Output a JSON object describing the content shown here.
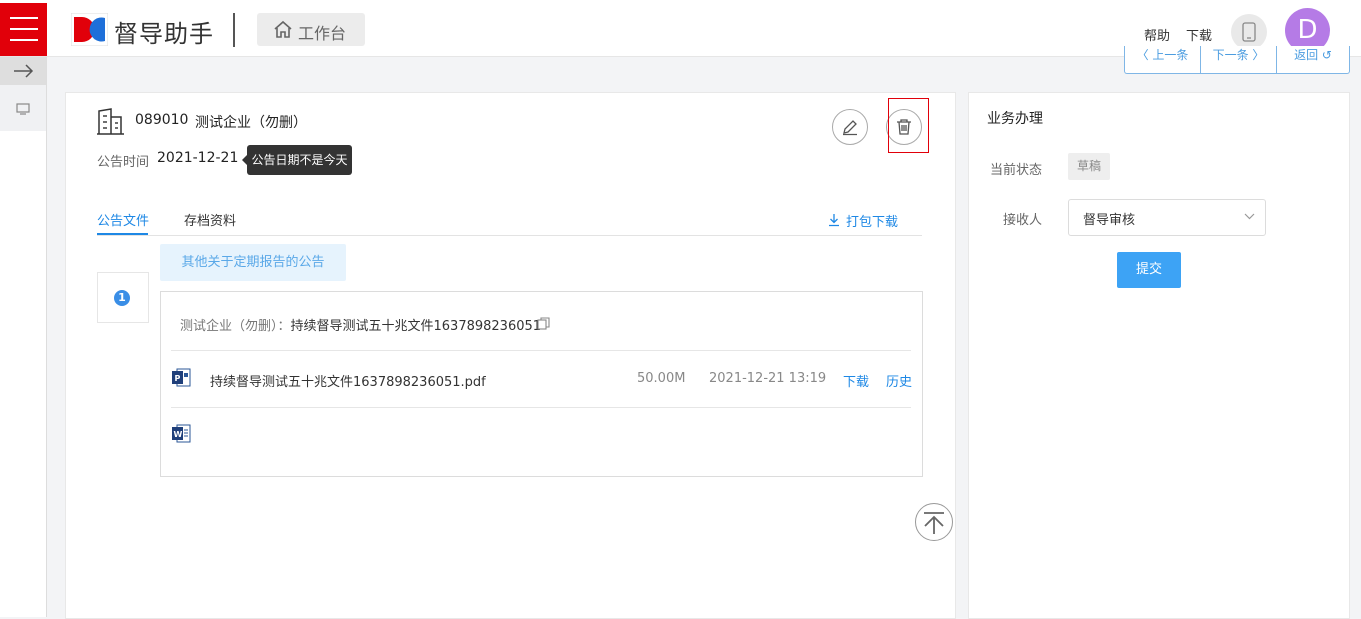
{
  "header": {
    "app_title": "督导助手",
    "workbench_label": "工作台",
    "help_label": "帮助",
    "download_label": "下载",
    "avatar_initial": "D"
  },
  "nav": {
    "prev_label": "〈 上一条",
    "next_label": "下一条 〉",
    "back_label": "返回 ↺"
  },
  "record": {
    "code": "089010",
    "company": "测试企业（勿删）",
    "date_label": "公告时间",
    "date_value": "2021-12-21",
    "tooltip": "公告日期不是今天"
  },
  "tabs": [
    {
      "label": "公告文件",
      "active": true
    },
    {
      "label": "存档资料",
      "active": false
    }
  ],
  "download_all": "打包下载",
  "notice_category": "其他关于定期报告的公告",
  "item_number": "1",
  "item": {
    "prefix": "测试企业（勿删）：",
    "title": "持续督导测试五十兆文件1637898236051"
  },
  "files": [
    {
      "icon": "pdf-file-icon",
      "name": "持续督导测试五十兆文件1637898236051.pdf",
      "size": "50.00M",
      "time": "2021-12-21 13:19",
      "download": "下载",
      "history": "历史"
    },
    {
      "icon": "word-file-icon",
      "name": "",
      "size": "",
      "time": "",
      "download": "",
      "history": ""
    }
  ],
  "business": {
    "title": "业务办理",
    "status_label": "当前状态",
    "status_value": "草稿",
    "receiver_label": "接收人",
    "receiver_value": "督导审核",
    "submit_label": "提交"
  },
  "colors": {
    "brand_red": "#e1000a",
    "accent_blue": "#1e88e5",
    "submit_blue": "#3da3f5",
    "avatar_purple": "#b57be6"
  }
}
